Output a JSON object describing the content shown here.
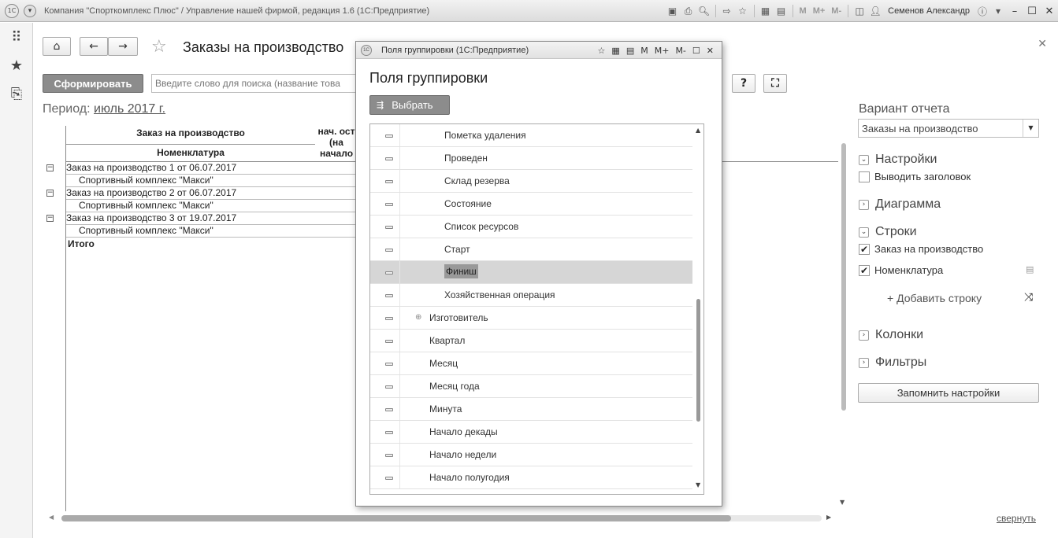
{
  "app": {
    "title": "Компания \"Спорткомплекс Плюс\" / Управление нашей фирмой, редакция 1.6  (1С:Предприятие)",
    "user": "Семенов Александр",
    "mem_buttons": [
      "M",
      "M+",
      "M-"
    ],
    "logo_text": "1С"
  },
  "form": {
    "title": "Заказы на производство",
    "generate_label": "Сформировать",
    "search_placeholder": "Введите слово для поиска (название това",
    "help_label": "?",
    "period_label": "Период:",
    "period_value": "июль 2017 г."
  },
  "report": {
    "header_col1": "Заказ на производство",
    "header_col1_sub": "Номенклатура",
    "header_col2": "нач. ост (на начало",
    "rows": [
      {
        "text": "Заказ на производство 1 от 06.07.2017",
        "level": 1
      },
      {
        "text": "Спортивный комплекс \"Макси\"",
        "level": 2
      },
      {
        "text": "Заказ на производство 2 от 06.07.2017",
        "level": 1
      },
      {
        "text": "Спортивный комплекс \"Макси\"",
        "level": 2
      },
      {
        "text": "Заказ на производство 3 от 19.07.2017",
        "level": 1
      },
      {
        "text": "Спортивный комплекс \"Макси\"",
        "level": 2
      }
    ],
    "total_label": "Итого"
  },
  "settings": {
    "variant_label": "Вариант отчета",
    "variant_value": "Заказы на производство",
    "sections": {
      "settings": "Настройки",
      "diagram": "Диаграмма",
      "rows": "Строки",
      "columns": "Колонки",
      "filters": "Фильтры"
    },
    "show_header_label": "Выводить заголовок",
    "row_fields": [
      {
        "label": "Заказ на производство",
        "checked": true
      },
      {
        "label": "Номенклатура",
        "checked": true
      }
    ],
    "add_row_label": "+ Добавить строку",
    "save_label": "Запомнить настройки",
    "collapse_label": "свернуть"
  },
  "modal": {
    "window_title": "Поля группировки  (1С:Предприятие)",
    "heading": "Поля группировки",
    "select_label": "Выбрать",
    "items": [
      {
        "label": "Пометка удаления",
        "indent": 2,
        "selected": false,
        "expandable": false
      },
      {
        "label": "Проведен",
        "indent": 2,
        "selected": false,
        "expandable": false
      },
      {
        "label": "Склад резерва",
        "indent": 2,
        "selected": false,
        "expandable": false
      },
      {
        "label": "Состояние",
        "indent": 2,
        "selected": false,
        "expandable": false
      },
      {
        "label": "Список ресурсов",
        "indent": 2,
        "selected": false,
        "expandable": false
      },
      {
        "label": "Старт",
        "indent": 2,
        "selected": false,
        "expandable": false
      },
      {
        "label": "Финиш",
        "indent": 2,
        "selected": true,
        "expandable": false
      },
      {
        "label": "Хозяйственная операция",
        "indent": 2,
        "selected": false,
        "expandable": false
      },
      {
        "label": "Изготовитель",
        "indent": 1,
        "selected": false,
        "expandable": true
      },
      {
        "label": "Квартал",
        "indent": 1,
        "selected": false,
        "expandable": false
      },
      {
        "label": "Месяц",
        "indent": 1,
        "selected": false,
        "expandable": false
      },
      {
        "label": "Месяц года",
        "indent": 1,
        "selected": false,
        "expandable": false
      },
      {
        "label": "Минута",
        "indent": 1,
        "selected": false,
        "expandable": false
      },
      {
        "label": "Начало декады",
        "indent": 1,
        "selected": false,
        "expandable": false
      },
      {
        "label": "Начало недели",
        "indent": 1,
        "selected": false,
        "expandable": false
      },
      {
        "label": "Начало полугодия",
        "indent": 1,
        "selected": false,
        "expandable": false
      }
    ],
    "toolbar": [
      "M",
      "M+",
      "M-"
    ]
  }
}
